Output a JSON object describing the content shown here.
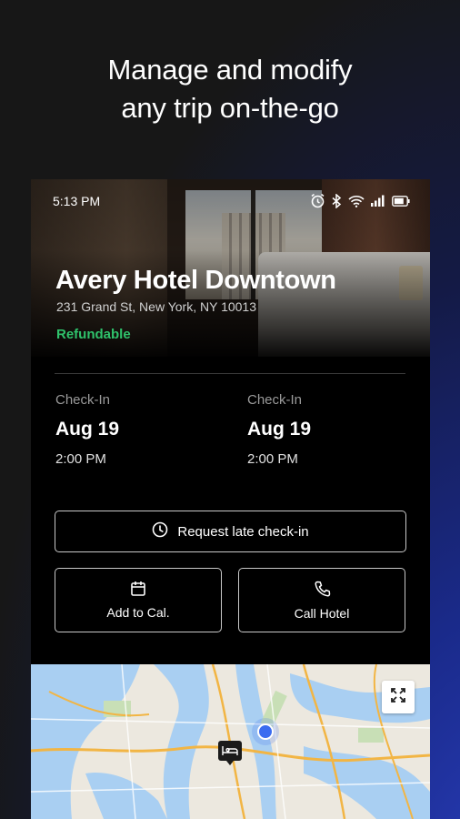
{
  "headline": {
    "line1": "Manage and modify",
    "line2": "any trip on-the-go"
  },
  "status_bar": {
    "time": "5:13 PM",
    "icons": [
      "alarm-icon",
      "bluetooth-icon",
      "wifi-icon",
      "signal-icon",
      "battery-icon"
    ]
  },
  "hotel": {
    "name": "Avery Hotel Downtown",
    "address": "231 Grand St, New York, NY 10013",
    "policy": "Refundable"
  },
  "check_in": {
    "label": "Check-In",
    "date": "Aug 19",
    "time": "2:00 PM"
  },
  "check_out": {
    "label": "Check-In",
    "date": "Aug 19",
    "time": "2:00 PM"
  },
  "actions": {
    "late_checkin": "Request late check-in",
    "add_to_cal": "Add to Cal.",
    "call_hotel": "Call Hotel"
  },
  "map": {
    "expand_icon": "expand-icon",
    "hotel_marker_icon": "bed-icon",
    "location_dot_icon": "location-dot-icon"
  },
  "colors": {
    "accent_green": "#2fc26b",
    "location_blue": "#3b6cf0",
    "background": "#1a1a1a",
    "card": "#000000"
  }
}
